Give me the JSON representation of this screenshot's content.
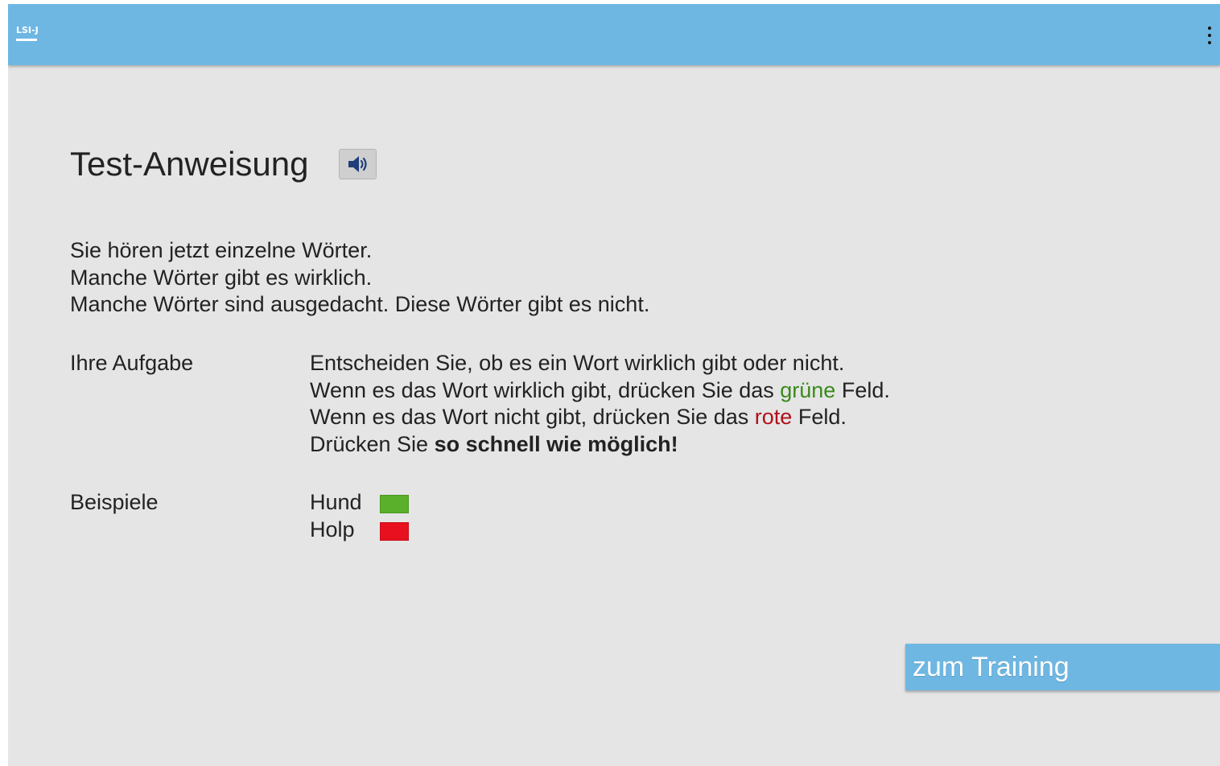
{
  "appbar": {
    "logo_text": "LSI-J",
    "menu_icon": "more-vertical-icon",
    "color": "#6fb7e3"
  },
  "main": {
    "title": "Test-Anweisung",
    "speaker_icon": "speaker-icon",
    "intro": [
      "Sie hören jetzt einzelne Wörter.",
      "Manche Wörter gibt es wirklich.",
      "Manche Wörter sind ausgedacht. Diese Wörter gibt es nicht."
    ],
    "task": {
      "label": "Ihre Aufgabe",
      "line1": "Entscheiden Sie, ob es ein Wort wirklich gibt oder nicht.",
      "line2_before": "Wenn es das Wort wirklich gibt, drücken Sie das ",
      "line2_highlight": "grüne",
      "line2_after": " Feld.",
      "line3_before": "Wenn es das Wort nicht gibt, drücken Sie das ",
      "line3_highlight": "rote",
      "line3_after": " Feld.",
      "line4_before": "Drücken Sie ",
      "line4_bold": "so schnell wie möglich!"
    },
    "examples": {
      "label": "Beispiele",
      "items": [
        {
          "word": "Hund",
          "color": "#5ab02a"
        },
        {
          "word": "Holp",
          "color": "#e8101e"
        }
      ]
    },
    "cta_label": "zum Training",
    "colors": {
      "green_text": "#3a8a1a",
      "red_text": "#b0101a",
      "button": "#6fb7e3"
    }
  }
}
